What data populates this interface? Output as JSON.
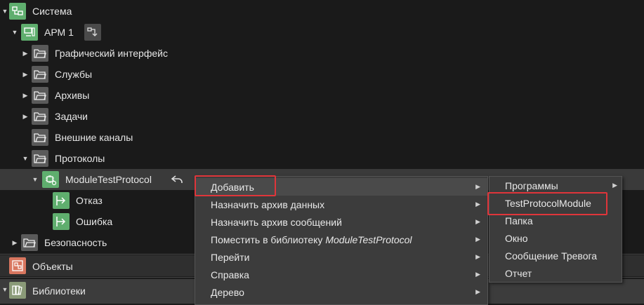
{
  "tree": {
    "system": "Система",
    "arm": "АРМ 1",
    "gui": "Графический интерфейс",
    "services": "Службы",
    "archives": "Архивы",
    "tasks": "Задачи",
    "ext_channels": "Внешние каналы",
    "protocols": "Протоколы",
    "module": "ModuleTestProtocol",
    "fail": "Отказ",
    "error": "Ошибка",
    "security": "Безопасность"
  },
  "panels": {
    "objects": "Объекты",
    "libraries": "Библиотеки"
  },
  "context_menu": {
    "add": "Добавить",
    "assign_data_archive": "Назначить архив данных",
    "assign_msg_archive": "Назначить архив сообщений",
    "place_in_library_prefix": "Поместить в библиотеку ",
    "place_in_library_name": "ModuleTestProtocol",
    "goto": "Перейти",
    "help": "Справка",
    "tree": "Дерево"
  },
  "submenu": {
    "programs": "Программы",
    "test_protocol_module": "TestProtocolModule",
    "folder": "Папка",
    "window": "Окно",
    "alarm_message": "Сообщение Тревога",
    "report": "Отчет"
  },
  "colors": {
    "highlight": "#e0353a",
    "green_icon": "#5fae6e",
    "red_icon": "#d8765f"
  }
}
